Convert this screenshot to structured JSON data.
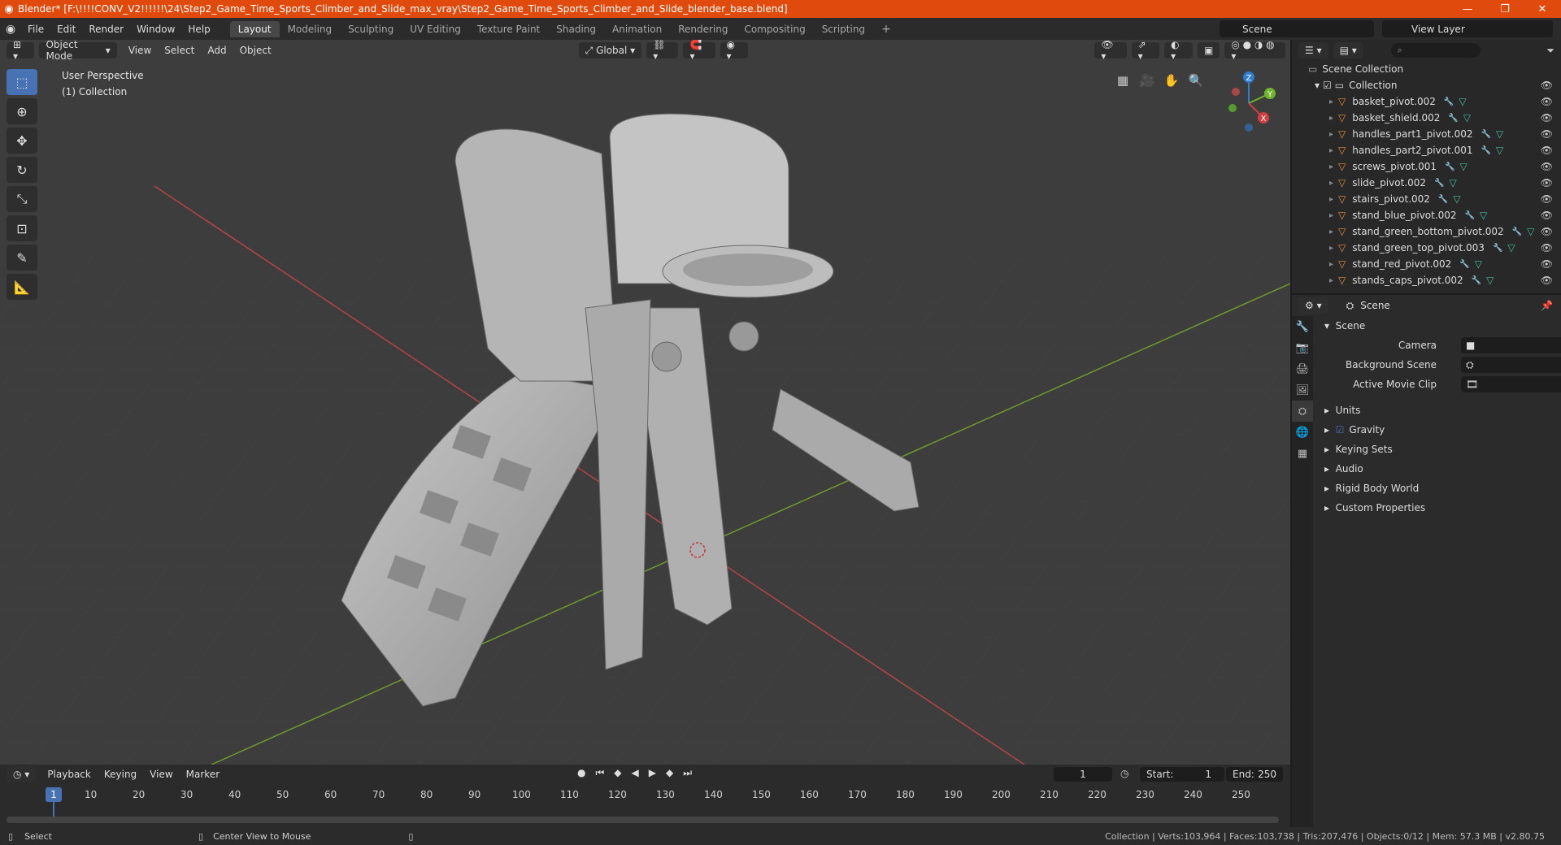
{
  "window": {
    "title": "Blender* [F:\\!!!!CONV_V2!!!!!!\\24\\Step2_Game_Time_Sports_Climber_and_Slide_max_vray\\Step2_Game_Time_Sports_Climber_and_Slide_blender_base.blend]",
    "minimize": "—",
    "restore": "❐",
    "close": "✕"
  },
  "menu": {
    "items": [
      "File",
      "Edit",
      "Render",
      "Window",
      "Help"
    ],
    "workspaces": [
      "Layout",
      "Modeling",
      "Sculpting",
      "UV Editing",
      "Texture Paint",
      "Shading",
      "Animation",
      "Rendering",
      "Compositing",
      "Scripting"
    ],
    "active_workspace": "Layout",
    "add_workspace": "+",
    "scene": "Scene",
    "view_layer": "View Layer"
  },
  "viewport": {
    "mode": "Object Mode",
    "menus": [
      "View",
      "Select",
      "Add",
      "Object"
    ],
    "transform_orientation": "Global",
    "perspective_label": "User Perspective",
    "collection_label": "(1) Collection",
    "gizmo_axes": {
      "x": "X",
      "y": "Y",
      "z": "Z"
    }
  },
  "outliner": {
    "root": "Scene Collection",
    "collection": "Collection",
    "objects": [
      "basket_pivot.002",
      "basket_shield.002",
      "handles_part1_pivot.002",
      "handles_part2_pivot.001",
      "screws_pivot.001",
      "slide_pivot.002",
      "stairs_pivot.002",
      "stand_blue_pivot.002",
      "stand_green_bottom_pivot.002",
      "stand_green_top_pivot.003",
      "stand_red_pivot.002",
      "stands_caps_pivot.002"
    ]
  },
  "properties": {
    "context": "Scene",
    "section": "Scene",
    "fields": {
      "camera": "Camera",
      "background_scene": "Background Scene",
      "active_movie_clip": "Active Movie Clip"
    },
    "panels": [
      "Units",
      "Gravity",
      "Keying Sets",
      "Audio",
      "Rigid Body World",
      "Custom Properties"
    ],
    "gravity_checked": true
  },
  "timeline": {
    "menus": [
      "Playback",
      "Keying",
      "View",
      "Marker"
    ],
    "current_frame": "1",
    "start_label": "Start:",
    "start": "1",
    "end_label": "End:",
    "end": "250",
    "ruler": [
      "10",
      "20",
      "30",
      "40",
      "50",
      "60",
      "70",
      "80",
      "90",
      "100",
      "110",
      "120",
      "130",
      "140",
      "150",
      "160",
      "170",
      "180",
      "190",
      "200",
      "210",
      "220",
      "230",
      "240",
      "250"
    ],
    "playhead": "1"
  },
  "status": {
    "left_action": "Select",
    "mid_action": "Center View to Mouse",
    "stats": "Collection | Verts:103,964 | Faces:103,738 | Tris:207,476 | Objects:0/12 | Mem: 57.3 MB | v2.80.75"
  },
  "colors": {
    "accent": "#4772b3",
    "titlebar": "#e14a0d",
    "object_icon": "#e8923c",
    "grid_x": "#b84444",
    "grid_y": "#6f9a2c"
  }
}
